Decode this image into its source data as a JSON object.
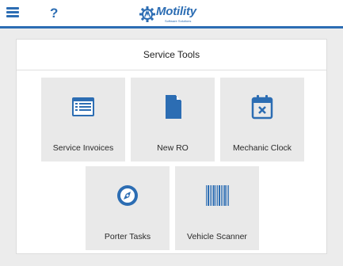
{
  "header": {
    "menu_icon": "hamburger-menu-icon",
    "help_label": "?",
    "logo": {
      "name": "Motility",
      "tagline": "Software Solutions"
    },
    "accent_color": "#2c6db3"
  },
  "panel": {
    "title": "Service Tools",
    "tiles": [
      {
        "label": "Service Invoices",
        "icon": "invoice-list-icon"
      },
      {
        "label": "New RO",
        "icon": "document-icon"
      },
      {
        "label": "Mechanic Clock",
        "icon": "calendar-x-icon"
      },
      {
        "label": "Porter Tasks",
        "icon": "compass-icon"
      },
      {
        "label": "Vehicle Scanner",
        "icon": "barcode-icon"
      }
    ]
  }
}
